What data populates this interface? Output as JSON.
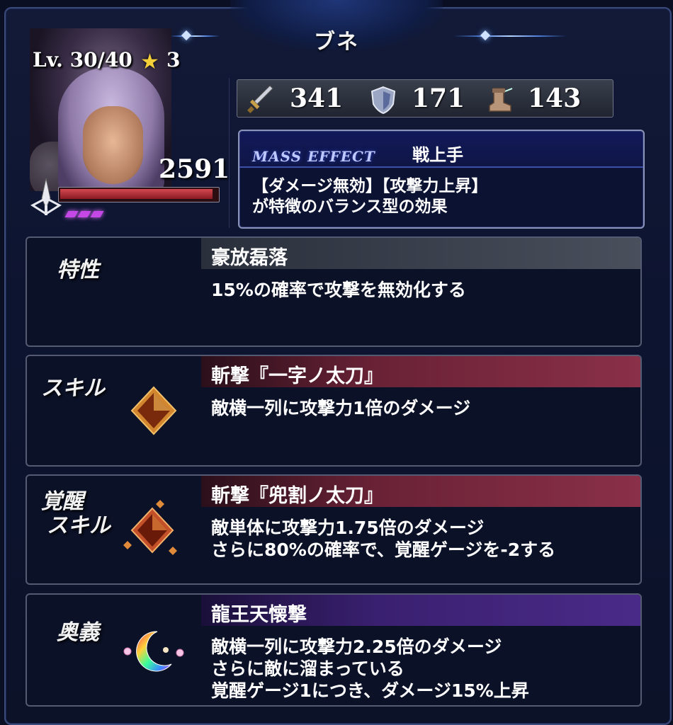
{
  "header": {
    "title": "ブネ"
  },
  "character": {
    "level": "Lv. 30/40",
    "rarity_stars": "3",
    "hp": "2591",
    "hp_fraction": 0.97,
    "weapon_icon": "sword-emblem-icon",
    "awakening_pips": 3
  },
  "stats": {
    "attack": {
      "icon": "sword-icon",
      "value": "341"
    },
    "defense": {
      "icon": "shield-icon",
      "value": "171"
    },
    "speed": {
      "icon": "boot-icon",
      "value": "143"
    }
  },
  "mass_effect": {
    "label": "MASS EFFECT",
    "name": "戦上手",
    "desc_line1": "【ダメージ無効】【攻撃力上昇】",
    "desc_line2": "が特徴のバランス型の効果"
  },
  "trait": {
    "label": "特性",
    "name": "豪放磊落",
    "desc_line1": "15%の確率で攻撃を無効化する",
    "bar_color": "#3a3f4c"
  },
  "skill": {
    "label": "スキル",
    "name": "斬撃『一字ノ太刀』",
    "desc_line1": "敵横一列に攻撃力1倍のダメージ",
    "bar_color": "#7a2a3c"
  },
  "awakened_skill": {
    "label_line1": "覚醒",
    "label_line2": "スキル",
    "name": "斬撃『兜割ノ太刀』",
    "desc_line1": "敵単体に攻撃力1.75倍のダメージ",
    "desc_line2": "さらに80%の確率で、覚醒ゲージを-2する",
    "bar_color": "#7a2a3c"
  },
  "ultimate": {
    "label": "奥義",
    "name": "龍王天懐撃",
    "desc_line1": "敵横一列に攻撃力2.25倍のダメージ",
    "desc_line2": "さらに敵に溜まっている",
    "desc_line3": "覚醒ゲージ1につき、ダメージ15%上昇",
    "bar_color": "#3c2470"
  }
}
